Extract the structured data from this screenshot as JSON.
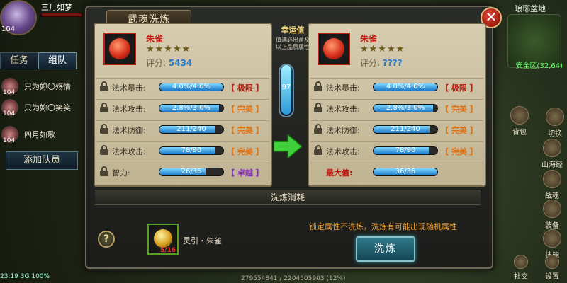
{
  "hud": {
    "player_name": "三月如梦",
    "player_level": "104",
    "tabs": [
      "任务",
      "组队"
    ],
    "members": [
      {
        "name": "只为妳〇殇情",
        "level": "104"
      },
      {
        "name": "只为妳〇笑笑",
        "level": "104"
      },
      {
        "name": "四月如歌",
        "level": "104"
      }
    ],
    "add_member": "添加队员",
    "zone_name": "琅琊盆地",
    "coord": "安全区(32,64)",
    "side_buttons": [
      "切换",
      "背包",
      "山海经",
      "战魂",
      "装备",
      "技能",
      "社交",
      "设置"
    ],
    "status_left": "23:19  3G  100%",
    "exp_text": "279554841 / 2204505903 (12%)"
  },
  "dialog": {
    "title": "武魂洗炼",
    "close_icon": "close-icon",
    "luck": {
      "title": "幸运值",
      "desc": "值满必出蓝及以上品质属性",
      "value": "97",
      "fill": 0.97
    },
    "consume_title": "洗炼消耗",
    "material": {
      "name": "灵引・朱雀",
      "count": "5/16"
    },
    "warning": "锁定属性不洗炼，洗炼有可能出现随机属性",
    "refine_label": "洗炼",
    "help_label": "?"
  },
  "left_item": {
    "name": "朱雀",
    "stars": "★★★★★",
    "score_label": "评分:",
    "score": "5434",
    "stats": [
      {
        "label": "法术暴击:",
        "value": "4.0%/4.0%",
        "fill": 1.0,
        "grade": "【 极限 】",
        "gclass": "g-limit"
      },
      {
        "label": "法术攻击:",
        "value": "2.8%/3.0%",
        "fill": 0.93,
        "grade": "【 完美 】",
        "gclass": "g-perfect"
      },
      {
        "label": "法术防御:",
        "value": "211/240",
        "fill": 0.88,
        "grade": "【 完美 】",
        "gclass": "g-perfect"
      },
      {
        "label": "法术攻击:",
        "value": "78/90",
        "fill": 0.87,
        "grade": "【 完美 】",
        "gclass": "g-perfect"
      },
      {
        "label": "智力:",
        "value": "26/36",
        "fill": 0.72,
        "grade": "【 卓越 】",
        "gclass": "g-exc"
      }
    ]
  },
  "right_item": {
    "name": "朱雀",
    "stars": "★★★★★",
    "score_label": "评分:",
    "score": "????",
    "stats": [
      {
        "label": "法术暴击:",
        "value": "4.0%/4.0%",
        "fill": 1.0,
        "grade": "【 极限 】",
        "gclass": "g-limit"
      },
      {
        "label": "法术攻击:",
        "value": "2.8%/3.0%",
        "fill": 0.93,
        "grade": "【 完美 】",
        "gclass": "g-perfect"
      },
      {
        "label": "法术防御:",
        "value": "211/240",
        "fill": 0.88,
        "grade": "【 完美 】",
        "gclass": "g-perfect"
      },
      {
        "label": "法术攻击:",
        "value": "78/90",
        "fill": 0.87,
        "grade": "【 完美 】",
        "gclass": "g-perfect"
      },
      {
        "label": "最大值:",
        "value": "36/36",
        "fill": 1.0,
        "grade": "",
        "gclass": ""
      }
    ]
  }
}
